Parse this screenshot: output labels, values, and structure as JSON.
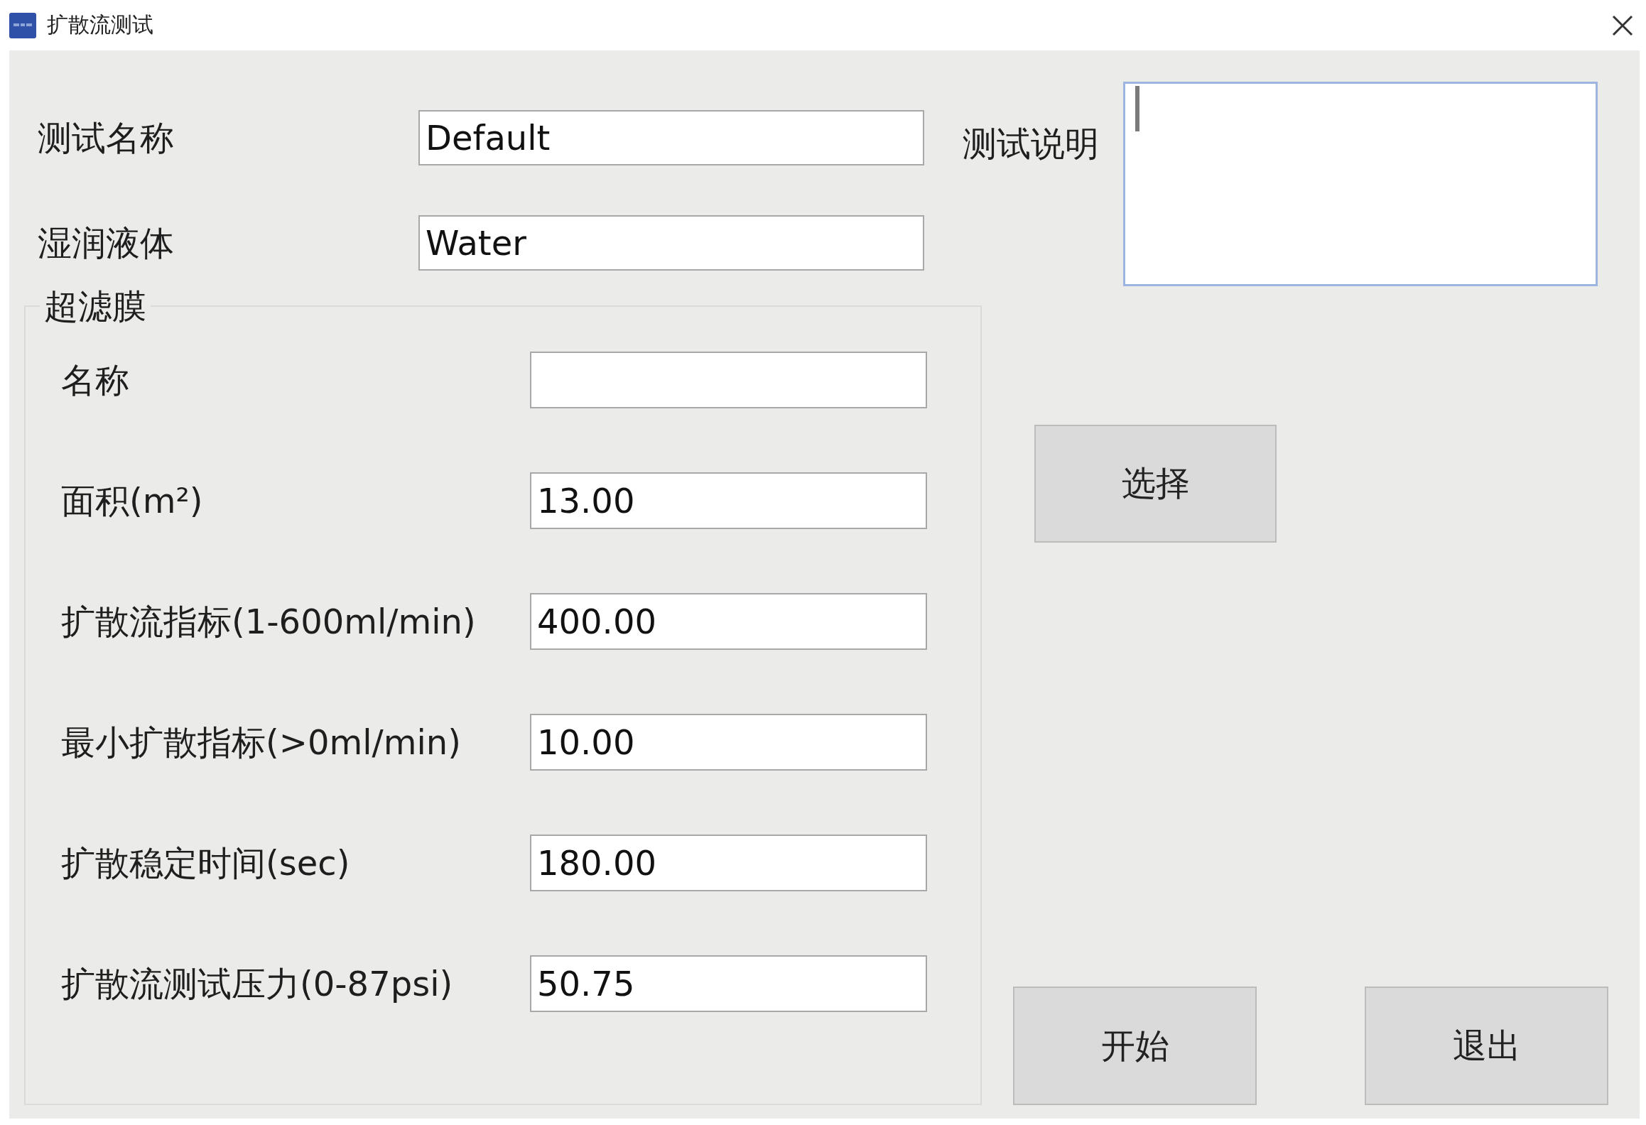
{
  "window": {
    "title": "扩散流测试"
  },
  "fields": [
    {
      "label": "测试名称",
      "value": "Default"
    },
    {
      "label": "湿润液体",
      "value": "Water"
    }
  ],
  "description": {
    "label": "测试说明",
    "focused": true
  },
  "membrane_group": {
    "title": "超滤膜",
    "fields": [
      {
        "label": "名称"
      },
      {
        "label": "面积(m²)",
        "value": "13.00"
      },
      {
        "label": "扩散流指标(1-600ml/min)",
        "value": "400.00"
      },
      {
        "label": "最小扩散指标(>0ml/min)",
        "value": "10.00"
      },
      {
        "label": "扩散稳定时间(sec)",
        "value": "180.00"
      },
      {
        "label": "扩散流测试压力(0-87psi)",
        "value": "50.75"
      }
    ]
  },
  "select_button": {
    "label": "选择"
  },
  "buttons": [
    {
      "label": "开始"
    },
    {
      "label": "退出"
    }
  ]
}
